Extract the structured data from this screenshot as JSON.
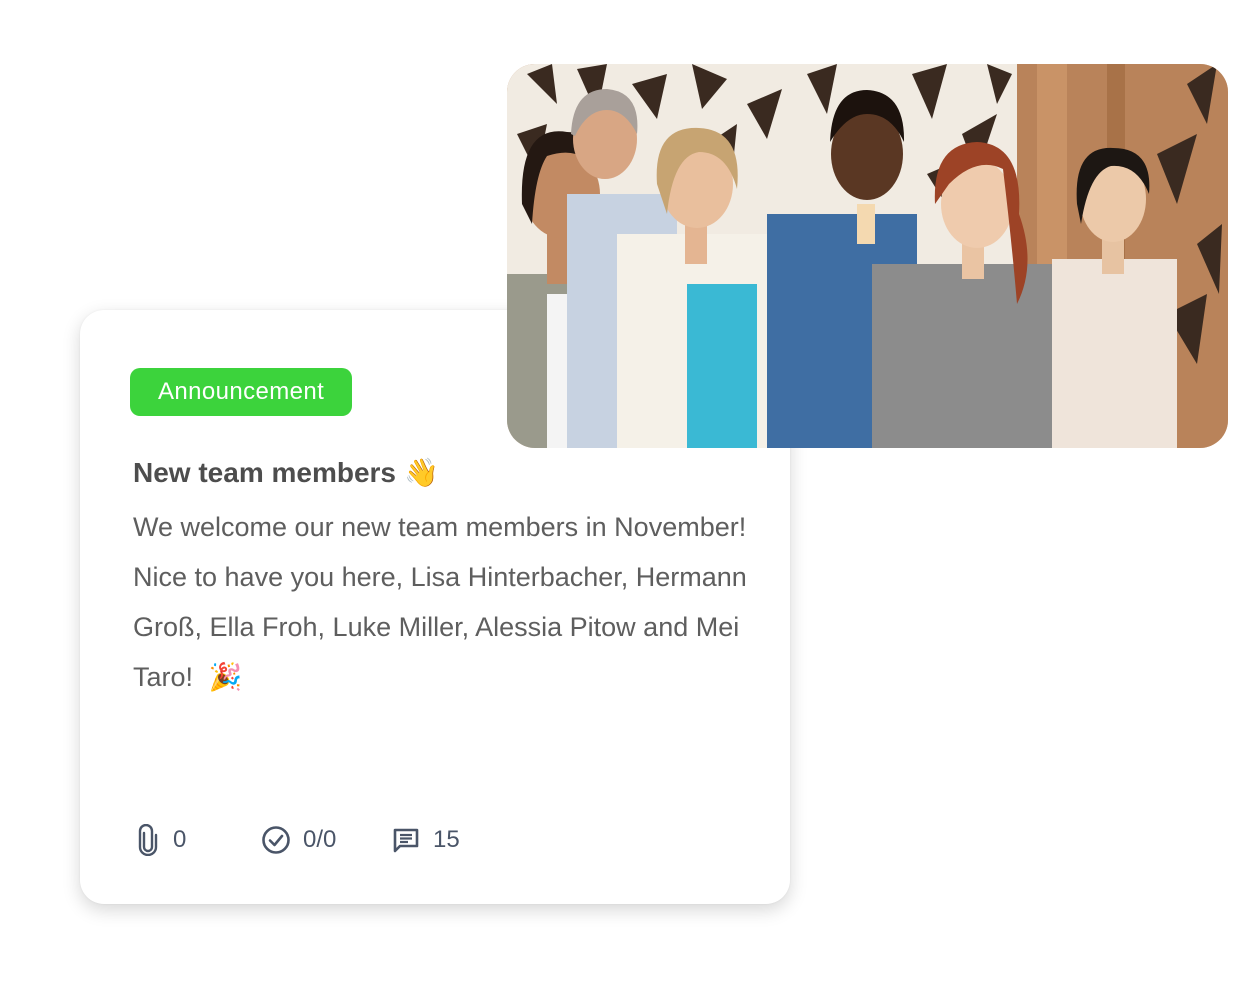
{
  "card": {
    "tag": "Announcement",
    "title": "New team members",
    "title_emoji": "👋",
    "body": "We welcome our new team members in November! Nice to have you here, Lisa Hinterbacher, Hermann Groß, Ella Froh, Luke Miller, Alessia Pitow and Mei Taro!",
    "body_emoji": "🎉",
    "stats": {
      "attachments": "0",
      "tasks": "0/0",
      "comments": "15"
    }
  },
  "colors": {
    "tag_background": "#3cd33c",
    "icon_color": "#4a5568"
  },
  "icons": [
    "paperclip-icon",
    "check-circle-icon",
    "comment-icon"
  ]
}
